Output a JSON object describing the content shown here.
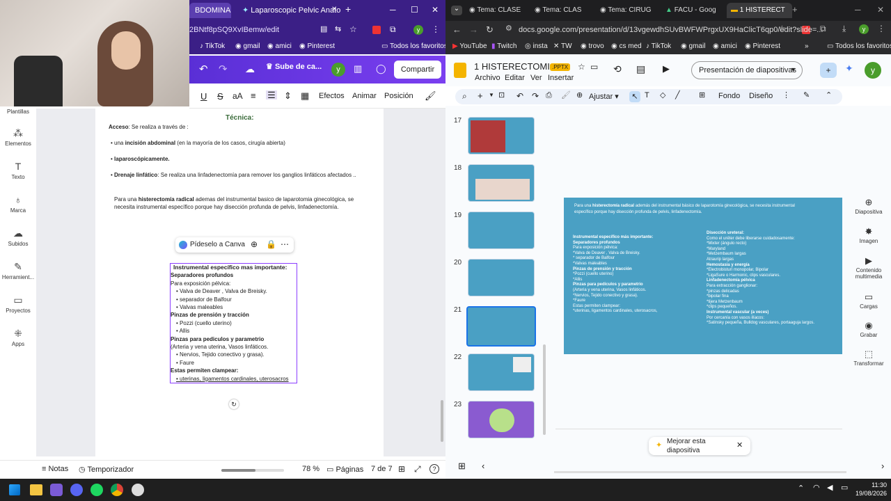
{
  "left_browser": {
    "tabs": [
      "BDOMINAL",
      "Laparoscopic Pelvic Anatomy (",
      "+"
    ],
    "url": "2BNtf8pSQ9XvIBemw/edit",
    "bookmarks": [
      "TikTok",
      "gmail",
      "amici",
      "Pinterest",
      "Todos los favoritos"
    ],
    "toolbar": {
      "upload_label": "Sube de ca...",
      "avatar": "y",
      "share_label": "Compartir"
    },
    "format_bar": [
      "U",
      "S",
      "aA",
      "Efectos",
      "Animar",
      "Posición"
    ],
    "sidebar": [
      "Plantillas",
      "Elementos",
      "Texto",
      "Marca",
      "Subidos",
      "Herramient...",
      "Proyectos",
      "Apps"
    ],
    "doc": {
      "heading": "Técnica:",
      "access_label": "Acceso",
      "access_text": ": Se realiza a través de :",
      "bullet1_pre": "una ",
      "bullet1_bold": "incisión abdominal",
      "bullet1_post": " (en la mayoría de los casos, cirugía abierta)",
      "bullet2": "laparoscópicamente.",
      "bullet3_bold": "Drenaje linfático",
      "bullet3_text": ": Se realiza una linfadenectomía para remover los ganglios linfáticos afectados ..",
      "para_line1_pre": "Para una ",
      "para_line1_bold": "histerectomía radical",
      "para_line1_post": " ademas del instrumental basico de laparotomia ginecológica, se",
      "para_line2": "necesita instrumental específico porque hay disección profunda de pelvis, linfadenectomía."
    },
    "popup": {
      "label": "Pídeselo a Canva"
    },
    "selected_text": [
      "Instrumental específico mas importante:",
      "Separadores profundos",
      "Para exposición pélvica:",
      "Valva de Deaver , Valva de Breisky.",
      "separador de Balfour",
      "Valvas maleables",
      "Pinzas de prensión y tracción",
      "Pozzi (cuello uterino)",
      "Allis",
      "Pinzas para pediculos y parametrio",
      "(Arteria y vena uterina, Vasos linfáticos.",
      "Nervios, Tejido conectivo y grasa).",
      "Faure",
      "Estas permiten clampear:",
      "uterinas, ligamentos cardinales, uterosacros"
    ],
    "footer": {
      "notes": "Notas",
      "timer": "Temporizador",
      "zoom": "78 %",
      "pages_label": "Páginas",
      "page_count": "7 de 7",
      "zoom_fraction": 0.78
    }
  },
  "right_browser": {
    "tabs": [
      "Tema: CLASE",
      "Tema: CLAS",
      "Tema: CIRUG",
      "FACU - Goog",
      "1 HISTERECT"
    ],
    "url": "docs.google.com/presentation/d/13vgewdhSUvBWFWPrgxUX9HaClicT6qp0/edit?slide=...",
    "bookmarks": [
      "YouTube",
      "Twitch",
      "insta",
      "TW",
      "trovo",
      "cs med",
      "TikTok",
      "gmail",
      "amici",
      "Pinterest",
      "Todos los favoritos"
    ],
    "app": {
      "title": "1 HISTERECTOMI...",
      "badge": ".PPTX",
      "menu": [
        "Archivo",
        "Editar",
        "Ver",
        "Insertar"
      ],
      "present_label": "Presentación de diapositivas",
      "avatar": "y"
    },
    "toolbar": {
      "fit": "Ajustar",
      "bg": "Fondo",
      "design": "Diseño"
    },
    "slide_numbers": [
      "17",
      "18",
      "19",
      "20",
      "21",
      "22",
      "23"
    ],
    "slide": {
      "intro1_pre": "Para una ",
      "intro1_bold": "histerectomía radical",
      "intro1_post": " además del instrumental básico de laparotomía ginecológica, se necesita instrumental",
      "intro2": "específico porque hay disección profunda de pelvis, linfadenectomía.",
      "left": [
        "Instrumental específico más importante:",
        "Separadores profundos",
        "Para exposición pélvica:",
        "*Valva de Deaver , Valva de Breisky.",
        "* separador de Balfour",
        "*Valvas maleables",
        "Pinzas de prensión y tracción",
        "*Pozzi (cuello uterino)",
        "*Allis",
        "Pinzas para pedículos y parametrio",
        "(Arteria y vena  uterina, Vasos linfáticos.",
        "*Nervios,  Tejido conectivo y grasa).",
        "*Faure",
        "Estas permiten clampear:",
        "*uterinas, ligamentos cardinales, uterosacros,"
      ],
      "right": [
        "Disección ureteral:",
        "Como el uréter debe liberarse cuidadosamente:",
        "*Mixter (ángulo recto)",
        "*Maryland",
        "*Metzembaum largas",
        "Atraurip largas",
        "Hemostasia y energía",
        "*Electrobisturí monopolar, Bipolar",
        "*LigaSure o Harmonic, clips vasculares.",
        "Linfadenectomía pélvica",
        "Para extracción ganglionar:",
        "*pinzas delicadas",
        "*bipolar fina",
        "*tijera Metzenbaum",
        "*clips pequeños.",
        "Instrumental vascular (a veces)",
        "Por cercanía con vasos ilíacos:",
        "*Satinsky pequeña, Bulldog vasculares, portaaguja largos."
      ]
    },
    "right_panel": [
      "Diapositiva",
      "Imagen",
      "Contenido multimedia",
      "Cargas",
      "Grabar",
      "Transformar"
    ],
    "improve": {
      "label": "Mejorar esta diapositiva"
    }
  },
  "taskbar": {
    "time": "11:30",
    "date": "19/08/2026"
  },
  "colors": {
    "canva_purple": "#7a3ff0",
    "slide_blue": "#4aa0c4",
    "gslides_yellow": "#f4b400"
  }
}
